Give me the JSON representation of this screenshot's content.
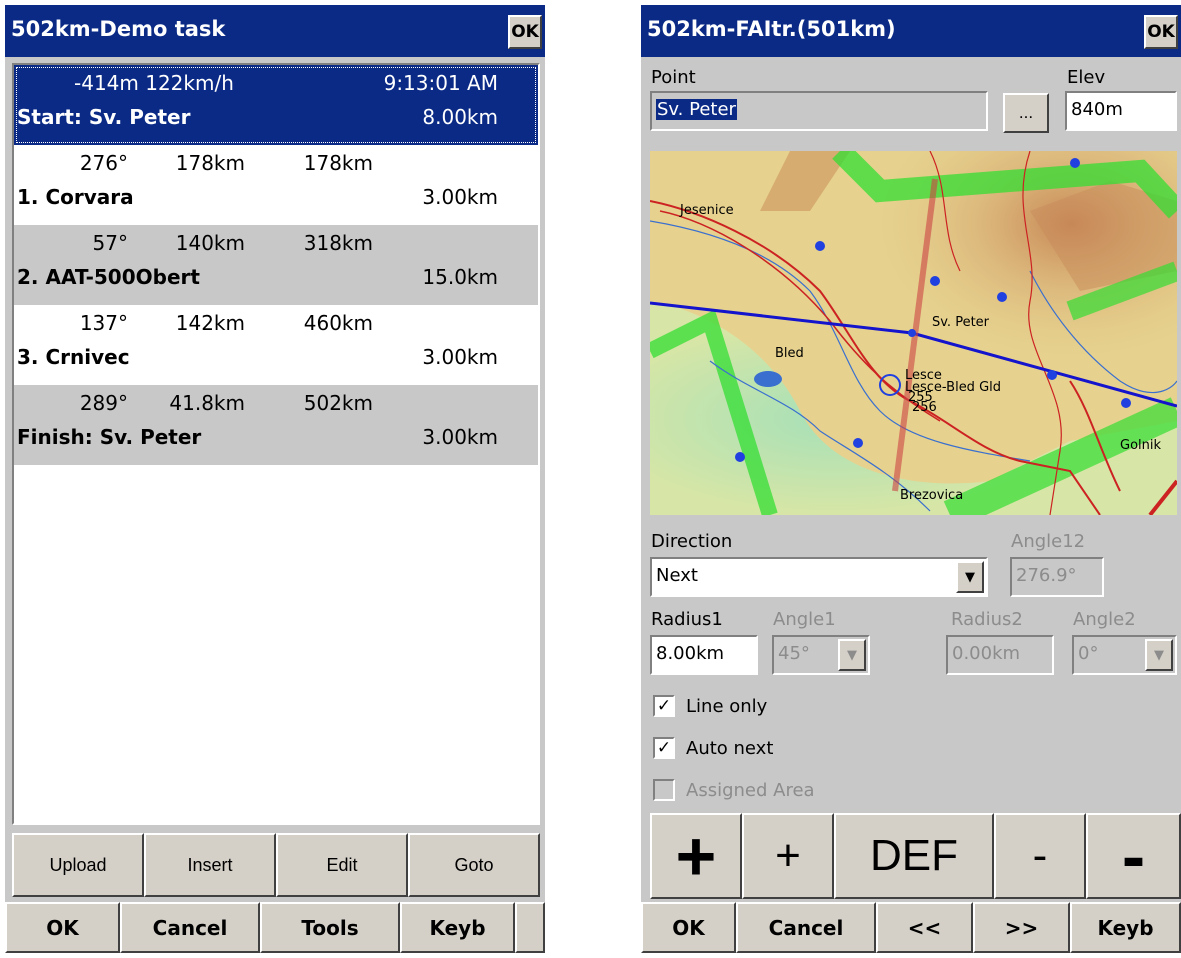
{
  "task_list_window": {
    "title": "502km-Demo task",
    "ok_label": "OK",
    "rows": [
      {
        "l1": {
          "left": "-414m 122km/h",
          "right": "9:13:01 AM"
        },
        "name": "Start: Sv. Peter",
        "dist": "8.00km"
      },
      {
        "bearing": "276°",
        "leg": "178km",
        "total": "178km",
        "name": "1. Corvara",
        "dist": "3.00km"
      },
      {
        "bearing": "57°",
        "leg": "140km",
        "total": "318km",
        "name": "2. AAT-500Obert",
        "dist": "15.0km"
      },
      {
        "bearing": "137°",
        "leg": "142km",
        "total": "460km",
        "name": "3. Crnivec",
        "dist": "3.00km"
      },
      {
        "bearing": "289°",
        "leg": "41.8km",
        "total": "502km",
        "name": "Finish: Sv. Peter",
        "dist": "3.00km"
      }
    ],
    "buttons": {
      "upload": "Upload",
      "insert": "Insert",
      "edit": "Edit",
      "goto": "Goto"
    },
    "menu": {
      "ok": "OK",
      "cancel": "Cancel",
      "tools": "Tools",
      "keyb": "Keyb"
    }
  },
  "waypoint_window": {
    "title": "502km-FAItr.(501km)",
    "ok_label": "OK",
    "point_label": "Point",
    "point_value": "Sv. Peter",
    "browse_label": "...",
    "elev_label": "Elev",
    "elev_value": "840m",
    "map_labels": {
      "jesenice": "Jesenice",
      "sv_peter": "Sv. Peter",
      "bled": "Bled",
      "lesce": "Lesce",
      "lesce_bled": "Lesce-Bled Gld",
      "n255": "255",
      "n256": "256",
      "golnik": "Golnik",
      "brezovica": "Brezovica"
    },
    "direction_label": "Direction",
    "direction_value": "Next",
    "angle12_label": "Angle12",
    "angle12_value": "276.9°",
    "radius1_label": "Radius1",
    "radius1_value": "8.00km",
    "angle1_label": "Angle1",
    "angle1_value": "45°",
    "radius2_label": "Radius2",
    "radius2_value": "0.00km",
    "angle2_label": "Angle2",
    "angle2_value": "0°",
    "checks": {
      "line_only": {
        "label": "Line only",
        "checked": true
      },
      "auto_next": {
        "label": "Auto next",
        "checked": true
      },
      "assigned_area": {
        "label": "Assigned Area",
        "checked": false
      }
    },
    "adjust_buttons": {
      "big_plus": "+",
      "plus": "+",
      "def": "DEF",
      "minus": "-",
      "big_minus": "-"
    },
    "menu": {
      "ok": "OK",
      "cancel": "Cancel",
      "prev": "<<",
      "next": ">>",
      "keyb": "Keyb"
    }
  },
  "colors": {
    "titlebar": "#0a2a86",
    "window_bg": "#c8c8c8",
    "selection": "#0a2a86",
    "airspace": "#33dd33",
    "task_line": "#1414cc",
    "rivers": "#3a6fcf",
    "roads": "#cc2222"
  }
}
